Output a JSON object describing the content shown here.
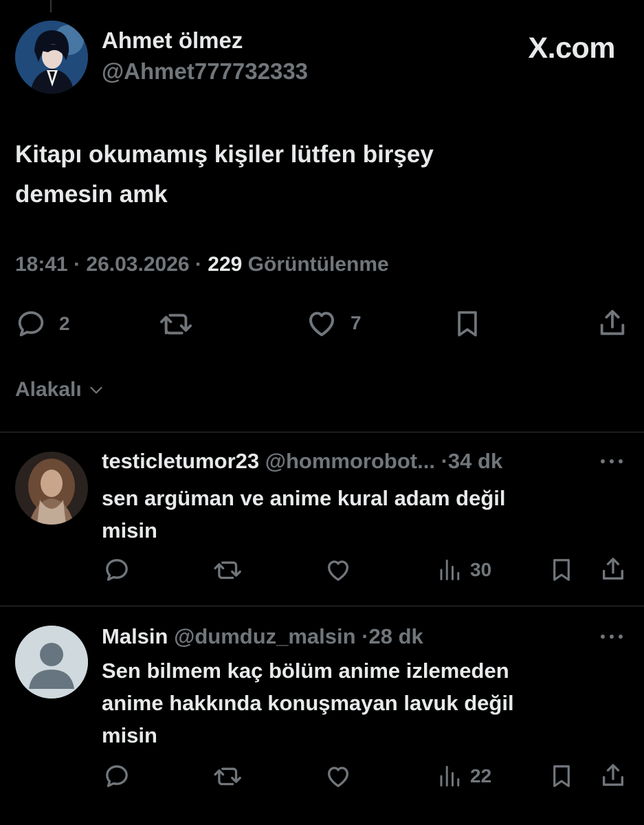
{
  "tweet": {
    "author_name": "Ahmet ölmez",
    "author_handle": "@Ahmet777732333",
    "brand": "X.com",
    "text_lines": [
      "Kitapı okumamış kişiler lütfen birşey",
      "demesin amk"
    ],
    "time": "18:41",
    "date": "26.03.2026",
    "views_count": "229",
    "views_label": "Görüntülenme",
    "separator": "·",
    "actions": {
      "reply_count": "2",
      "repost_count": "",
      "like_count": "7"
    },
    "icons": [
      "reply-icon",
      "repost-icon",
      "like-icon",
      "bookmark-icon",
      "share-icon"
    ]
  },
  "sort": {
    "label": "Alakalı",
    "icon": "chevron-down-icon"
  },
  "replies": [
    {
      "name": "testicletumor23",
      "handle": "@hommorobot...",
      "separator": "·",
      "time": "34 dk",
      "text_lines": [
        "sen argüman ve anime kural adam değil",
        "misin"
      ],
      "views": "30"
    },
    {
      "name": "Malsin",
      "handle": "@dumduz_malsin",
      "separator": "·",
      "time": "28 dk",
      "text_lines": [
        "Sen bilmem kaç bölüm anime izlemeden",
        "anime hakkında konuşmayan lavuk değil",
        "misin"
      ],
      "views": "22"
    }
  ],
  "colors": {
    "background": "#000000",
    "text_primary": "#e7e9ea",
    "text_secondary": "#71767b",
    "divider": "#2f3336"
  }
}
